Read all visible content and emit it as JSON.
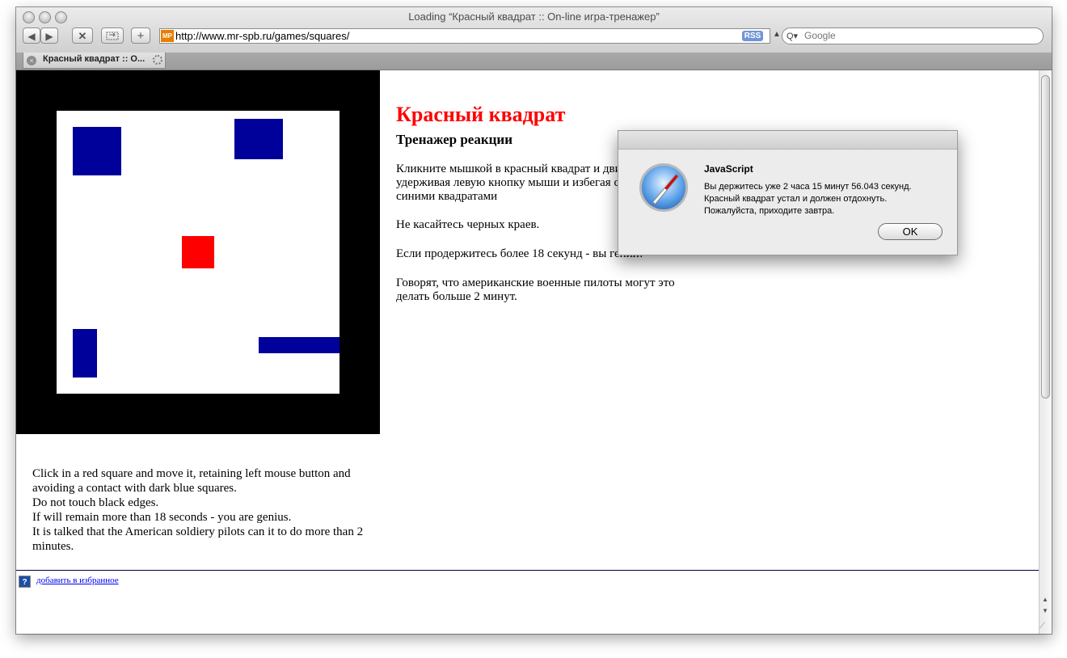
{
  "window": {
    "title": "Loading “Красный квадрат :: On-line игра-тренажер”"
  },
  "toolbar": {
    "back_icon": "◀",
    "forward_icon": "▶",
    "stop_icon": "✕",
    "add_icon": "+"
  },
  "address": {
    "favicon_text": "MP",
    "url": "http://www.mr-spb.ru/games/squares/",
    "rss_label": "RSS"
  },
  "search": {
    "placeholder": "Google"
  },
  "tab": {
    "label": "Красный квадрат :: O..."
  },
  "page": {
    "title": "Красный квадрат",
    "subtitle": "Тренажер реакции",
    "paragraphs": [
      "Кликните мышкой в красный квадрат и двигайте его, удерживая левую кнопку мыши и избегая столкновений с синими квадратами",
      "Не касайтесь черных краев.",
      "Если продержитесь более 18 секунд - вы гений!",
      "Говорят, что американские военные пилоты могут это делать больше 2 минут."
    ],
    "english_lines": [
      "Click in a red square and move it, retaining left mouse button and avoiding a contact with dark blue squares.",
      "Do not touch black edges.",
      "If will remain more than 18 seconds - you are genius.",
      "It is talked that the American soldiery pilots can it to do more than 2 minutes."
    ],
    "favorite_icon": "?",
    "favorite_link": "добавить в избранное"
  },
  "game": {
    "border_color": "#000000",
    "blue_color": "#00009a",
    "red_color": "#ff0000"
  },
  "dialog": {
    "title": "JavaScript",
    "lines": [
      "Вы держитесь уже 2 часа 15 минут 56.043 секунд.",
      "Красный квадрат устал и должен отдохнуть.",
      "Пожалуйста, приходите завтра."
    ],
    "ok_label": "OK"
  },
  "scroll": {
    "up_icon": "▲",
    "down_icon": "▼"
  }
}
